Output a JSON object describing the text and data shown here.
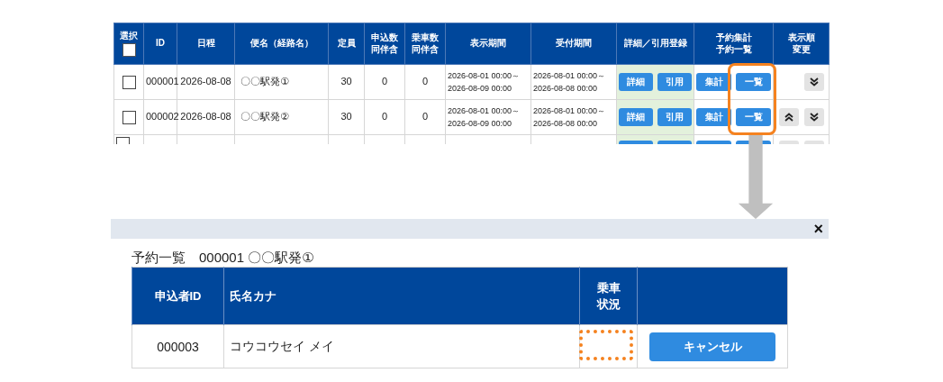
{
  "trips_table": {
    "columns": [
      {
        "label": "選択",
        "kind": "select"
      },
      {
        "label": "ID"
      },
      {
        "label": "日程"
      },
      {
        "label": "便名（経路名）"
      },
      {
        "label": "定員"
      },
      {
        "label": "申込数同伴含",
        "wrap": true
      },
      {
        "label": "乗車数同伴含",
        "wrap": true
      },
      {
        "label": "表示期間"
      },
      {
        "label": "受付期間"
      },
      {
        "label": "詳細／引用登録"
      },
      {
        "label": "予約集計予約一覧",
        "wrap": true
      },
      {
        "label": "表示順変更",
        "wrap": true
      }
    ],
    "select_all": {
      "checked": false
    },
    "cut_off_row": {
      "selected": false
    },
    "rows": [
      {
        "selected": false,
        "id": "000001",
        "date": "2026-08-08",
        "name": "〇〇駅発①",
        "capacity": "30",
        "applications": "0",
        "boarded": "0",
        "display_period": [
          "2026-08-01 00:00～",
          "2026-08-09 00:00"
        ],
        "reception_period": [
          "2026-08-01 00:00～",
          "2026-08-08 00:00"
        ],
        "buttons": [
          "詳細",
          "引用",
          "集計",
          "一覧"
        ],
        "move_up": false,
        "move_down": true
      },
      {
        "selected": false,
        "id": "000002",
        "date": "2026-08-08",
        "name": "〇〇駅発②",
        "capacity": "30",
        "applications": "0",
        "boarded": "0",
        "display_period": [
          "2026-08-01 00:00～",
          "2026-08-09 00:00"
        ],
        "reception_period": [
          "2026-08-01 00:00～",
          "2026-08-08 00:00"
        ],
        "buttons": [
          "詳細",
          "引用",
          "集計",
          "一覧"
        ],
        "move_up": true,
        "move_down": true
      }
    ]
  },
  "dialog": {
    "close": "×",
    "title": "予約一覧　000001 〇〇駅発①",
    "columns": [
      "申込者ID",
      "氏名カナ",
      "乗車状況",
      ""
    ],
    "rows": [
      {
        "applicant_id": "000003",
        "name_kana": "コウコウセイ メイ",
        "boarding_status": "",
        "action": "キャンセル"
      }
    ]
  }
}
